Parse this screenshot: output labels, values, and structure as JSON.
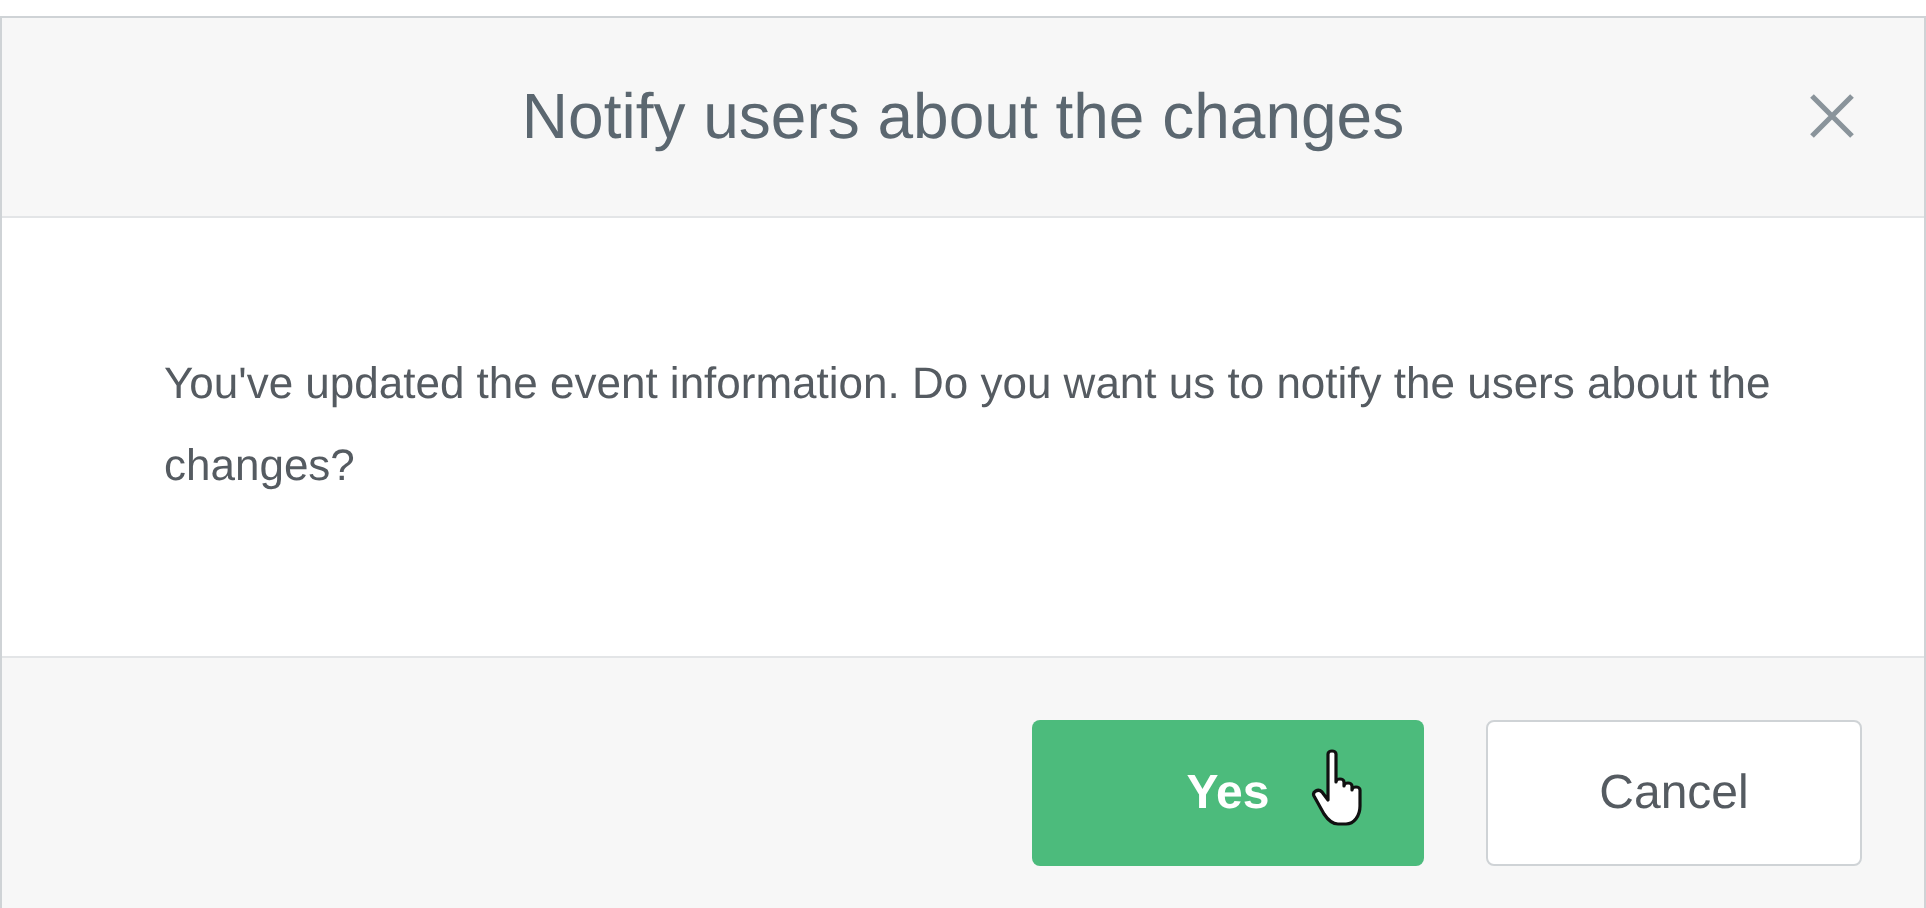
{
  "dialog": {
    "title": "Notify users about the changes",
    "message": "You've updated the event information. Do you want us to notify the users about the changes?",
    "buttons": [
      {
        "label": "Yes",
        "kind": "primary"
      },
      {
        "label": "Cancel",
        "kind": "secondary"
      }
    ]
  }
}
